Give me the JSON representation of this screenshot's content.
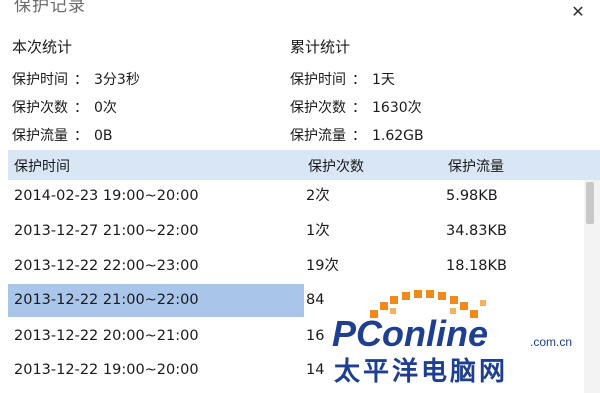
{
  "window": {
    "title": "保护记录",
    "close_icon": "close-icon"
  },
  "session": {
    "heading": "本次统计",
    "items": [
      {
        "label": "保护时间",
        "sep": "：",
        "value": "3分3秒"
      },
      {
        "label": "保护次数",
        "sep": "：",
        "value": "0次"
      },
      {
        "label": "保护流量",
        "sep": "：",
        "value": "0B"
      }
    ]
  },
  "total": {
    "heading": "累计统计",
    "items": [
      {
        "label": "保护时间",
        "sep": "：",
        "value": "1天"
      },
      {
        "label": "保护次数",
        "sep": "：",
        "value": "1630次"
      },
      {
        "label": "保护流量",
        "sep": "：",
        "value": "1.62GB"
      }
    ]
  },
  "table": {
    "columns": [
      "保护时间",
      "保护次数",
      "保护流量"
    ],
    "rows": [
      {
        "time": "2014-02-23 19:00~20:00",
        "count": "2次",
        "flow": "5.98KB"
      },
      {
        "time": "2013-12-27 21:00~22:00",
        "count": "1次",
        "flow": "34.83KB"
      },
      {
        "time": "2013-12-22 22:00~23:00",
        "count": "19次",
        "flow": "18.18KB"
      },
      {
        "time": "2013-12-22 21:00~22:00",
        "count": "84",
        "flow": ""
      },
      {
        "time": "2013-12-22 20:00~21:00",
        "count": "16",
        "flow": ""
      },
      {
        "time": "2013-12-22 19:00~20:00",
        "count": "14",
        "flow": ""
      }
    ],
    "selected_row": 3
  },
  "watermark": {
    "brand": "PConline",
    "domain": ".com.cn",
    "cn_name": "太平洋电脑网"
  },
  "colors": {
    "header_bg": "#d9e6f5",
    "selected_bg": "#a9c6ea",
    "brand_orange": "#f08a1c",
    "brand_blue": "#1e3f8f"
  }
}
